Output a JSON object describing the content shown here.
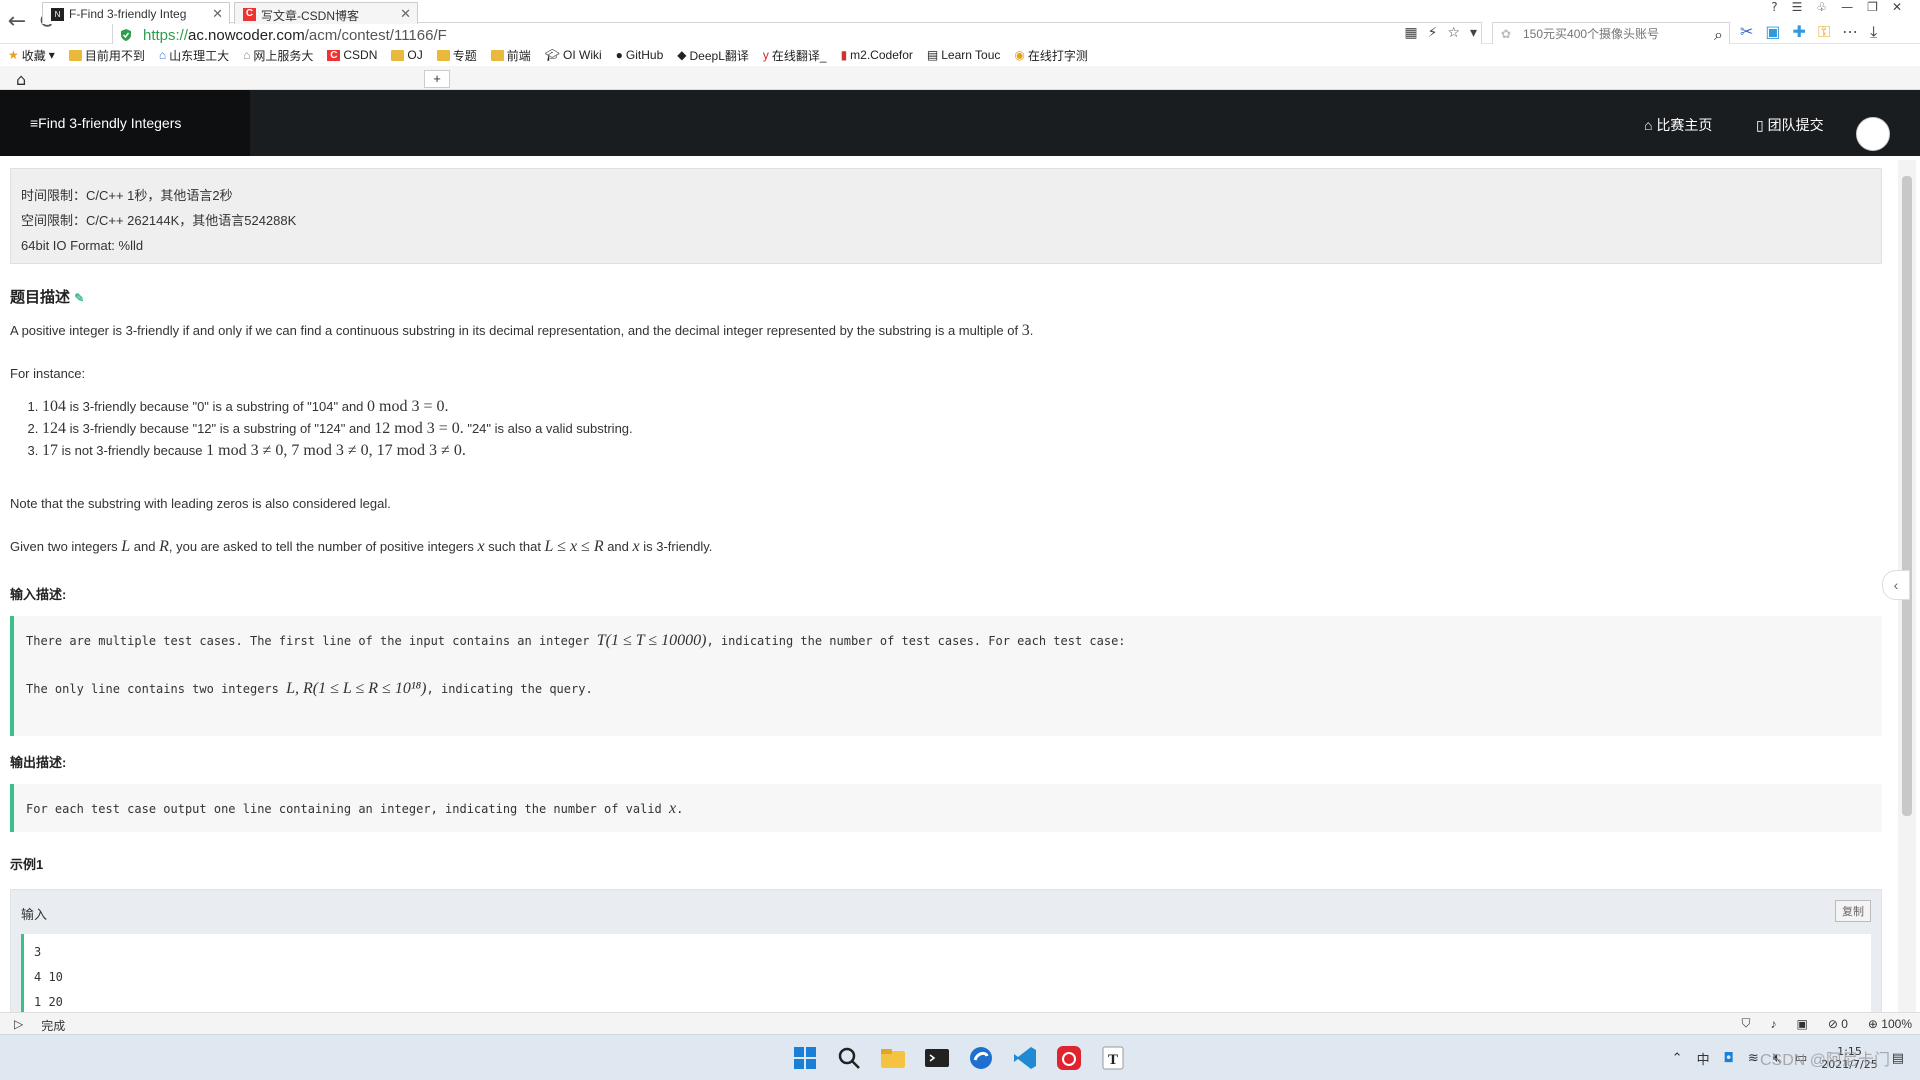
{
  "browser": {
    "url_scheme": "https://",
    "url_host": "ac.nowcoder.com",
    "url_path": "/acm/contest/11166/F",
    "search_placeholder": "150元买400个摄像头账号",
    "bookmarks": [
      "收藏",
      "目前用不到",
      "山东理工大",
      "网上服务大",
      "CSDN",
      "OJ",
      "专题",
      "前端",
      "OI Wiki",
      "GitHub",
      "DeepL翻译",
      "在线翻译_",
      "m2.Codefor",
      "Learn Touc",
      "在线打字测"
    ],
    "tabs": [
      {
        "label": "F-Find 3-friendly Integ",
        "active": true
      },
      {
        "label": "写文章-CSDN博客",
        "active": false
      }
    ],
    "status_text": "完成",
    "zoom": "100%",
    "status_count": "0"
  },
  "header": {
    "problem_title": "Find 3-friendly Integers",
    "contest_home": "比赛主页",
    "team_submit": "团队提交"
  },
  "limits": {
    "time": "时间限制：C/C++ 1秒，其他语言2秒",
    "space": "空间限制：C/C++ 262144K，其他语言524288K",
    "io": "64bit IO Format: %lld"
  },
  "problem": {
    "desc_heading": "题目描述",
    "intro": "A positive integer is 3-friendly if and only if we can find a continuous substring in its decimal representation, and the decimal integer represented by the substring is a multiple of",
    "intro_num": "3",
    "for_instance": "For instance:",
    "ex1_num": "104",
    "ex1_text": " is 3-friendly because \"0\" is a substring of \"104\" and ",
    "ex1_math": "0  mod 3 = 0.",
    "ex2_num": "124",
    "ex2_text": " is 3-friendly because \"12\" is a substring of \"124\" and ",
    "ex2_math": "12  mod 3 = 0.",
    "ex2_tail": " \"24\" is also a valid substring.",
    "ex3_num": "17",
    "ex3_text": " is not 3-friendly because ",
    "ex3_math": "1  mod 3 ≠ 0,  7  mod 3 ≠ 0,  17  mod 3 ≠ 0.",
    "note": "Note that the substring with leading zeros is also considered legal.",
    "given_a": "Given two integers ",
    "given_L": "L",
    "given_and": " and ",
    "given_R": "R",
    "given_b": ", you are asked to tell the number of positive integers ",
    "given_x": "x",
    "given_c": " such that ",
    "given_ineq": "L ≤ x ≤ R",
    "given_d": " and ",
    "given_e": " is 3-friendly."
  },
  "input_section": {
    "heading": "输入描述:",
    "line1_a": "There are multiple test cases. The first line of the input contains an integer ",
    "line1_math": "T(1 ≤ T ≤ 10000)",
    "line1_b": ", indicating the number of test cases. For each test case:",
    "line2_a": "The only line contains two integers ",
    "line2_math": "L, R(1 ≤ L ≤ R ≤ 10¹⁸)",
    "line2_b": ", indicating the query."
  },
  "output_section": {
    "heading": "输出描述:",
    "line_a": "For each test case output one line containing an integer, indicating the number of valid ",
    "line_x": "x",
    "line_b": "."
  },
  "sample": {
    "heading": "示例1",
    "input_label": "输入",
    "copy_label": "复制",
    "lines": [
      "3",
      "4 10",
      "1 20"
    ]
  },
  "taskbar": {
    "time": "1:15",
    "date": "2021/7/25",
    "watermark": "CSDN @阿尼卡门"
  }
}
